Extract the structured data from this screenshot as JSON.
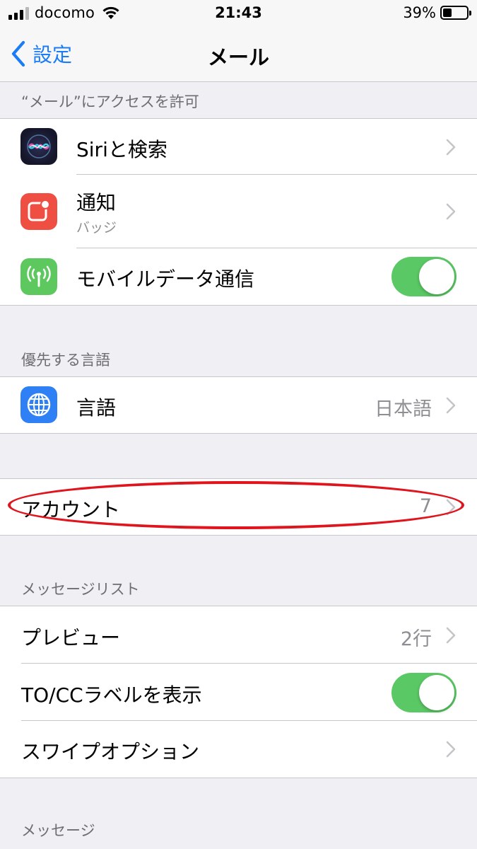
{
  "status_bar": {
    "carrier": "docomo",
    "time": "21:43",
    "battery": "39%",
    "battery_level": 0.39
  },
  "nav": {
    "back_label": "設定",
    "title": "メール"
  },
  "sections": {
    "access": {
      "header": "“メール”にアクセスを許可",
      "siri": {
        "label": "Siriと検索",
        "icon": "siri-icon"
      },
      "notifications": {
        "label": "通知",
        "sub": "バッジ",
        "icon": "notification-icon"
      },
      "cellular": {
        "label": "モバイルデータ通信",
        "icon": "antenna-icon",
        "toggle_on": true
      }
    },
    "language": {
      "header": "優先する言語",
      "language_row": {
        "label": "言語",
        "value": "日本語",
        "icon": "globe-icon"
      }
    },
    "accounts": {
      "accounts_row": {
        "label": "アカウント",
        "value": "7"
      }
    },
    "message_list": {
      "header": "メッセージリスト",
      "preview": {
        "label": "プレビュー",
        "value": "2行"
      },
      "to_cc": {
        "label": "TO/CCラベルを表示",
        "toggle_on": true
      },
      "swipe": {
        "label": "スワイプオプション"
      }
    },
    "messages": {
      "header": "メッセージ"
    }
  },
  "colors": {
    "accent_blue": "#1a7cf6",
    "toggle_green": "#5ac864",
    "notification_red": "#ef4e42",
    "cellular_green": "#5cc85e",
    "globe_blue": "#2f80f5",
    "highlight_red": "#e0141c"
  }
}
